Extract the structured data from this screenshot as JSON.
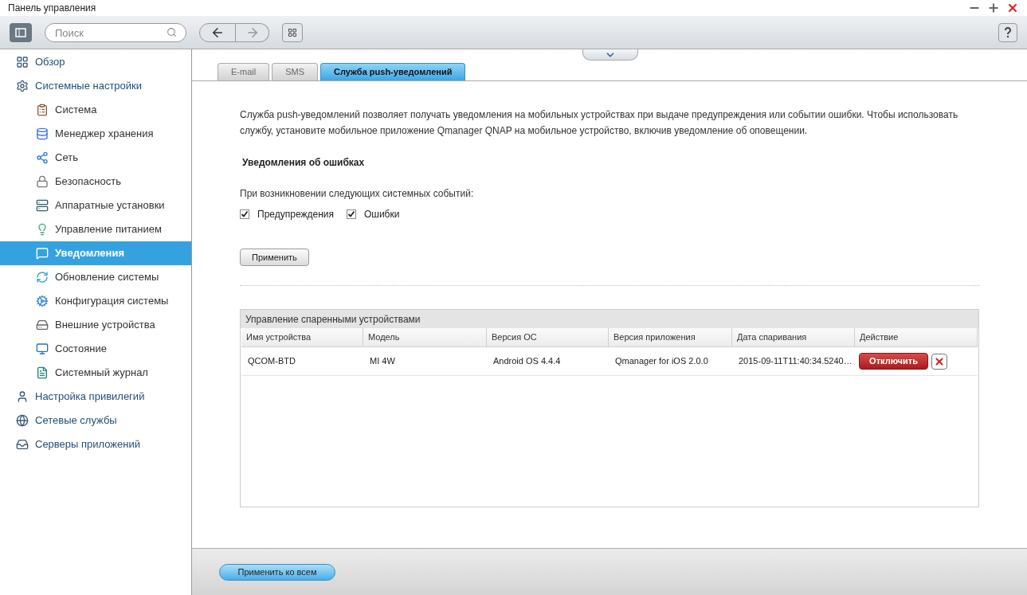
{
  "window": {
    "title": "Панель управления"
  },
  "toolbar": {
    "search": {
      "placeholder": "Поиск"
    }
  },
  "sidebar": {
    "items": [
      {
        "label": "Обзор",
        "selected": false
      },
      {
        "label": "Системные настройки",
        "selected": false,
        "children": [
          {
            "label": "Система",
            "selected": false
          },
          {
            "label": "Менеджер хранения",
            "selected": false
          },
          {
            "label": "Сеть",
            "selected": false
          },
          {
            "label": "Безопасность",
            "selected": false
          },
          {
            "label": "Аппаратные установки",
            "selected": false
          },
          {
            "label": "Управление питанием",
            "selected": false
          },
          {
            "label": "Уведомления",
            "selected": true
          },
          {
            "label": "Обновление системы",
            "selected": false
          },
          {
            "label": "Конфигурация системы",
            "selected": false
          },
          {
            "label": "Внешние устройства",
            "selected": false
          },
          {
            "label": "Состояние",
            "selected": false
          },
          {
            "label": "Системный журнал",
            "selected": false
          }
        ]
      },
      {
        "label": "Настройка привилегий",
        "selected": false
      },
      {
        "label": "Сетевые службы",
        "selected": false
      },
      {
        "label": "Серверы приложений",
        "selected": false
      }
    ]
  },
  "tabs": [
    {
      "label": "E-mail",
      "selected": false
    },
    {
      "label": "SMS",
      "selected": false
    },
    {
      "label": "Служба push-уведомлений",
      "selected": true
    }
  ],
  "description": "Служба push-уведомлений позволяет получать уведомления на мобильных устройствах при выдаче предупреждения или событии ошибки. Чтобы использовать службу, установите мобильное приложение Qmanager QNAP на мобильное устройство, включив уведомление об оповещении.",
  "section_title": "Уведомления об ошибках",
  "events_label": "При возникновении следующих системных событий:",
  "checkboxes": [
    {
      "label": "Предупреждения",
      "checked": true
    },
    {
      "label": "Ошибки",
      "checked": true
    }
  ],
  "apply_button": "Применить",
  "devices": {
    "title": "Управление спаренными устройствами",
    "columns": [
      "Имя устройства",
      "Модель",
      "Версия ОС",
      "Версия приложения",
      "Дата спаривания",
      "Действие"
    ],
    "rows": [
      {
        "cells": [
          "QCOM-BTD",
          "MI 4W",
          "Android OS 4.4.4",
          "Qmanager for iOS 2.0.0",
          "2015-09-11T11:40:34.5240…"
        ],
        "action": "Отключить"
      }
    ]
  },
  "footer": {
    "apply_all_button": "Применить ко всем"
  }
}
